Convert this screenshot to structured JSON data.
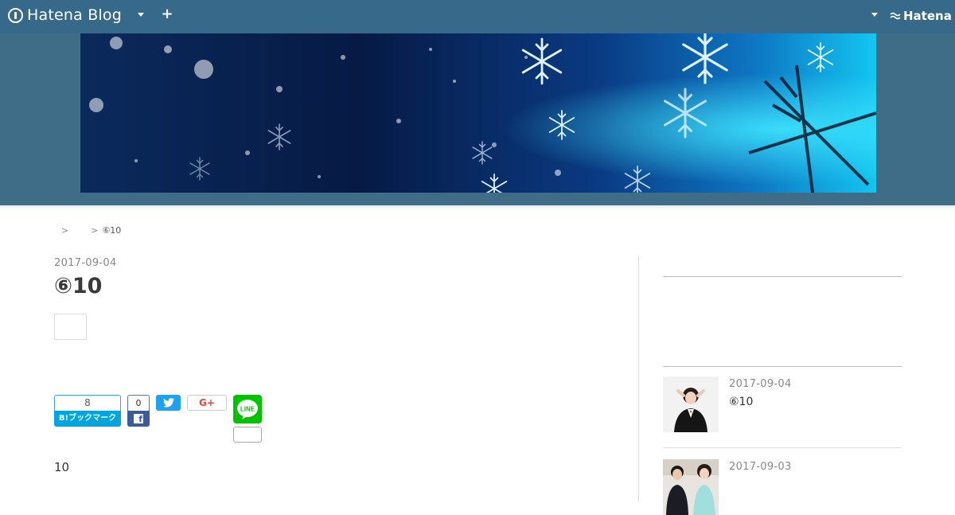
{
  "globalbar": {
    "logo_text": "Hatena Blog",
    "brand_text": "Hatena",
    "colors": {
      "bar": "#37698b",
      "header": "#3f6d88"
    }
  },
  "breadcrumb": {
    "items": [
      "",
      "",
      "⑥10"
    ],
    "separator": ">"
  },
  "entry": {
    "date": "2017-09-04",
    "title": "⑥10",
    "body": "10"
  },
  "social": {
    "hatena_bookmark": {
      "count": "8",
      "label": "B!ブックマーク"
    },
    "facebook": {
      "count": "0",
      "icon": "facebook-icon"
    },
    "twitter": {
      "icon": "twitter-icon"
    },
    "google_plus": {
      "label": "G+"
    },
    "line": {
      "label": "LINE"
    }
  },
  "sidebar": {
    "entries": [
      {
        "date": "2017-09-04",
        "title": "⑥10",
        "thumb": "person-photo-icon"
      },
      {
        "date": "2017-09-03",
        "title": "",
        "thumb": "couple-photo-icon"
      }
    ]
  }
}
